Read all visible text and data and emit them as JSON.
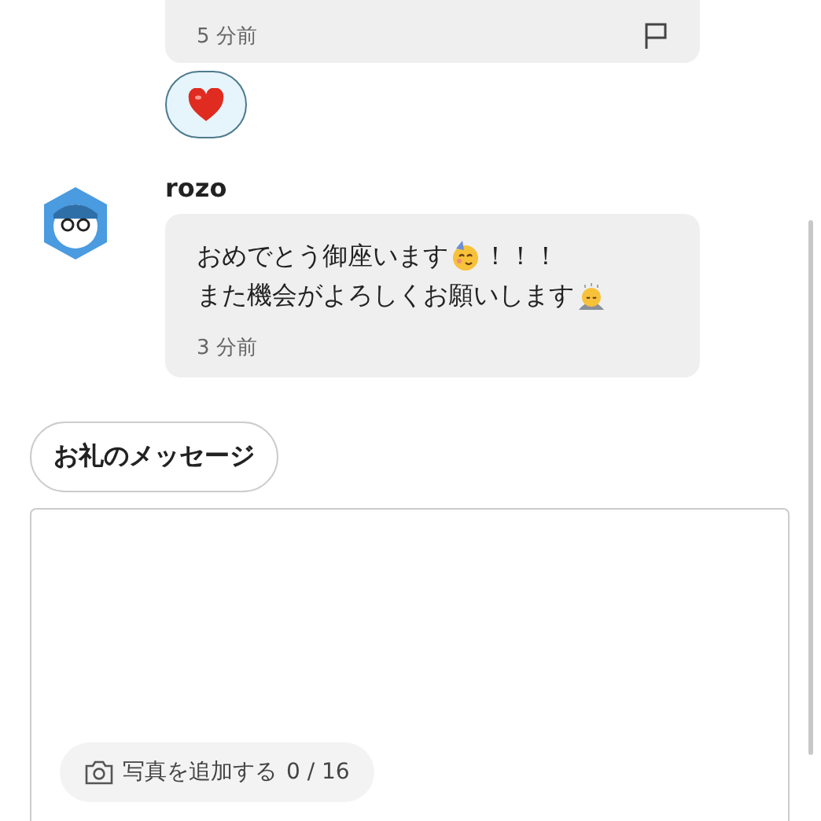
{
  "messages": [
    {
      "time": "5 分前",
      "flag": true,
      "reactions": [
        {
          "kind": "heart",
          "selected": true
        }
      ]
    },
    {
      "author": "rozo",
      "lines": [
        [
          {
            "kind": "text",
            "text": "おめでとう御座います"
          },
          {
            "kind": "party-face"
          },
          {
            "kind": "text",
            "text": "！！！"
          }
        ],
        [
          {
            "kind": "text",
            "text": "また機会がよろしくお願いします"
          },
          {
            "kind": "bowing"
          }
        ]
      ],
      "time": "3 分前"
    }
  ],
  "thanks_button": "お礼のメッセージ",
  "composer": {
    "photo_button": "写真を追加する",
    "photo_count": "0 / 16"
  }
}
